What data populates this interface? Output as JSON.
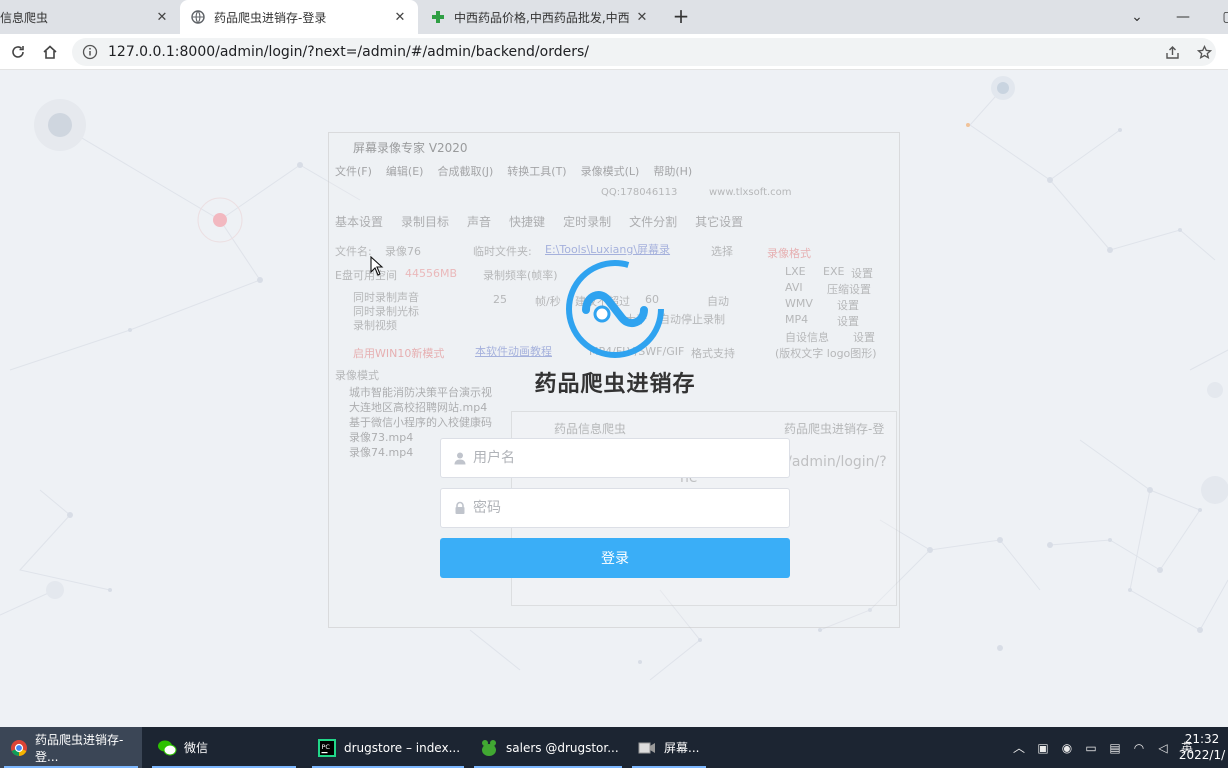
{
  "browser": {
    "tabs": [
      {
        "title": "信息爬虫",
        "active": false
      },
      {
        "title": "药品爬虫进销存-登录",
        "active": true
      },
      {
        "title": "中西药品价格,中西药品批发,中西",
        "active": false
      }
    ],
    "new_tab": "+",
    "url": "127.0.0.1:8000/admin/login/?next=/admin/#/admin/backend/orders/",
    "icons": [
      "reload-icon",
      "home-icon",
      "info-icon",
      "share-icon",
      "star-icon"
    ]
  },
  "login": {
    "title": "药品爬虫进销存",
    "username_placeholder": "用户名",
    "password_placeholder": "密码",
    "submit_label": "登录",
    "accent_color": "#3aaef7"
  },
  "overlay": {
    "window_title": "屏幕录像专家 V2020",
    "menu": [
      "文件(F)",
      "编辑(E)",
      "合成截取(J)",
      "转换工具(T)",
      "录像模式(L)",
      "帮助(H)"
    ],
    "tabs": [
      "基本设置",
      "录制目标",
      "声音",
      "快捷键",
      "定时录制",
      "文件分割",
      "其它设置"
    ],
    "qq": "QQ:178046113",
    "site": "www.tlxsoft.com",
    "filename_label": "文件名:",
    "filename_value": "录像76",
    "tempdir_label": "临时文件夹:",
    "tempdir_value": "E:\\Tools\\Luxiang\\屏幕录",
    "select_label": "选择",
    "disk_label": "E盘可用空间",
    "disk_value": "44556MB",
    "rate_label": "录制频率(帧率)",
    "fps_value": "25",
    "fps_unit": "帧/秒",
    "suggest_label": "建议不超过",
    "suggest_value": "60",
    "auto_label": "自动",
    "option_1": "同时录制声音",
    "option_2": "同时录制光标",
    "option_3": "录制视频",
    "win10_mode": "启用WIN10新模式",
    "format_label": "录像格式",
    "formats": [
      "LXE",
      "EXE",
      "AVI",
      "WMV",
      "MP4"
    ],
    "format_settings": [
      "设置",
      "压缩设置",
      "设置",
      "设置"
    ],
    "custom_info": "自设信息",
    "custom_settings": "设置",
    "copyright": "(版权文字 logo图形)",
    "stop_label": "大于",
    "stop_value": "自动停止录制",
    "tutorial_link": "本软件动画教程",
    "format_support_list": "MP4/FLV/SWF/GIF",
    "format_support": "格式支持",
    "record_mode": "录像模式",
    "files": [
      "城市智能消防决策平台演示视",
      "大连地区高校招聘网站.mp4",
      "基于微信小程序的入校健康码",
      "录像73.mp4",
      "录像74.mp4"
    ],
    "inner_tabs": [
      "药品信息爬虫",
      "药品爬虫进销存-登"
    ],
    "inner_url": "127.0.0.1:8000/admin/login/?ne"
  },
  "taskbar": {
    "items": [
      {
        "label": "药品爬虫进销存-登...",
        "icon": "chrome-icon",
        "active": true
      },
      {
        "label": "微信",
        "icon": "wechat-icon",
        "active": false
      },
      {
        "label": "drugstore – index...",
        "icon": "pycharm-icon",
        "active": false
      },
      {
        "label": "salers @drugstor...",
        "icon": "navicat-icon",
        "active": false
      },
      {
        "label": "屏幕...",
        "icon": "recorder-icon",
        "active": false
      }
    ],
    "ime": "英",
    "time": "21:32",
    "date": "2022/1/"
  }
}
